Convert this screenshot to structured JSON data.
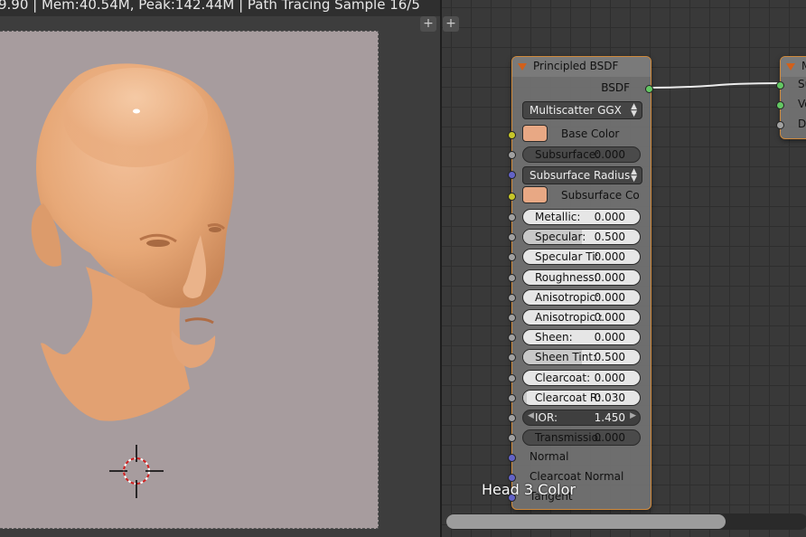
{
  "viewport": {
    "header_text": "9.90 | Mem:40.54M, Peak:142.44M | Path Tracing Sample 16/5",
    "corner_buttons": [
      "+",
      "+"
    ]
  },
  "principled_node": {
    "title": "Principled BSDF",
    "output_label": "BSDF",
    "distribution": "Multiscatter GGX",
    "base_color_label": "Base Color",
    "base_color_hex": "#e8a884",
    "subsurface": {
      "label": "Subsurface:",
      "value": "0.000"
    },
    "subsurface_method": "Subsurface Radius",
    "subsurface_color_label": "Subsurface Co",
    "subsurface_color_hex": "#e8a884",
    "fields": [
      {
        "label": "Metallic:",
        "value": "0.000"
      },
      {
        "label": "Specular:",
        "value": "0.500"
      },
      {
        "label": "Specular Ti:",
        "value": "0.000"
      },
      {
        "label": "Roughness:",
        "value": "0.000"
      },
      {
        "label": "Anisotropic:",
        "value": "0.000"
      },
      {
        "label": "Anisotropic :",
        "value": "0.000"
      },
      {
        "label": "Sheen:",
        "value": "0.000"
      },
      {
        "label": "Sheen Tint:",
        "value": "0.500"
      },
      {
        "label": "Clearcoat:",
        "value": "0.000"
      },
      {
        "label": "Clearcoat R:",
        "value": "0.030"
      }
    ],
    "ior": {
      "label": "IOR:",
      "value": "1.450"
    },
    "transmission": {
      "label": "Transmissio:",
      "value": "0.000"
    },
    "inputs": [
      "Normal",
      "Clearcoat Normal",
      "Tangent"
    ]
  },
  "output_node": {
    "title": "M",
    "sockets": [
      "Su",
      "Vo",
      "Di"
    ]
  },
  "status_text": "Head 3 Color"
}
